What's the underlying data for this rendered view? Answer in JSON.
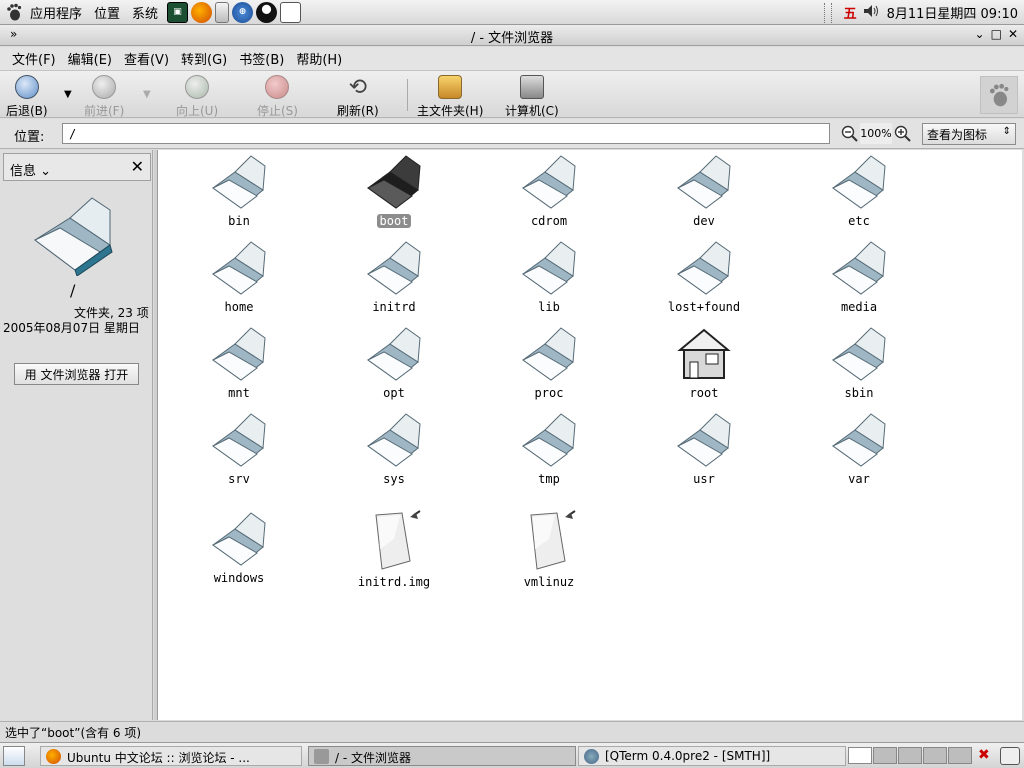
{
  "top_panel": {
    "menus": [
      "应用程序",
      "位置",
      "系统"
    ],
    "tray": {
      "indicator": "五",
      "clock": "8月11日星期四 09:10"
    }
  },
  "window": {
    "title": "/ - 文件浏览器"
  },
  "menubar": [
    "文件(F)",
    "编辑(E)",
    "查看(V)",
    "转到(G)",
    "书签(B)",
    "帮助(H)"
  ],
  "toolbar": {
    "back": "后退(B)",
    "forward": "前进(F)",
    "up": "向上(U)",
    "stop": "停止(S)",
    "reload": "刷新(R)",
    "home": "主文件夹(H)",
    "computer": "计算机(C)"
  },
  "location": {
    "label": "位置:",
    "value": "/",
    "zoom": "100%",
    "view_as": "查看为图标"
  },
  "sidepane": {
    "selector": "信息",
    "name": "/",
    "type": "文件夹, 23 项",
    "date": "2005年08月07日 星期日",
    "open_button": "用 文件浏览器 打开"
  },
  "files": [
    {
      "name": "bin",
      "kind": "folder"
    },
    {
      "name": "boot",
      "kind": "folder",
      "selected": true
    },
    {
      "name": "cdrom",
      "kind": "folder-link"
    },
    {
      "name": "dev",
      "kind": "folder"
    },
    {
      "name": "etc",
      "kind": "folder"
    },
    {
      "name": "home",
      "kind": "folder"
    },
    {
      "name": "initrd",
      "kind": "folder"
    },
    {
      "name": "lib",
      "kind": "folder"
    },
    {
      "name": "lost+found",
      "kind": "folder"
    },
    {
      "name": "media",
      "kind": "folder"
    },
    {
      "name": "mnt",
      "kind": "folder"
    },
    {
      "name": "opt",
      "kind": "folder"
    },
    {
      "name": "proc",
      "kind": "folder"
    },
    {
      "name": "root",
      "kind": "home"
    },
    {
      "name": "sbin",
      "kind": "folder"
    },
    {
      "name": "srv",
      "kind": "folder"
    },
    {
      "name": "sys",
      "kind": "folder"
    },
    {
      "name": "tmp",
      "kind": "folder"
    },
    {
      "name": "usr",
      "kind": "folder"
    },
    {
      "name": "var",
      "kind": "folder"
    },
    {
      "name": "windows",
      "kind": "folder"
    },
    {
      "name": "initrd.img",
      "kind": "file-link"
    },
    {
      "name": "vmlinuz",
      "kind": "file-link"
    }
  ],
  "statusbar": "选中了“boot”(含有 6 项)",
  "taskbar": [
    {
      "label": "Ubuntu 中文论坛 :: 浏览论坛 - ...",
      "active": false
    },
    {
      "label": "/ - 文件浏览器",
      "active": true
    },
    {
      "label": "[QTerm 0.4.0pre2 - [SMTH]]",
      "active": false
    }
  ]
}
